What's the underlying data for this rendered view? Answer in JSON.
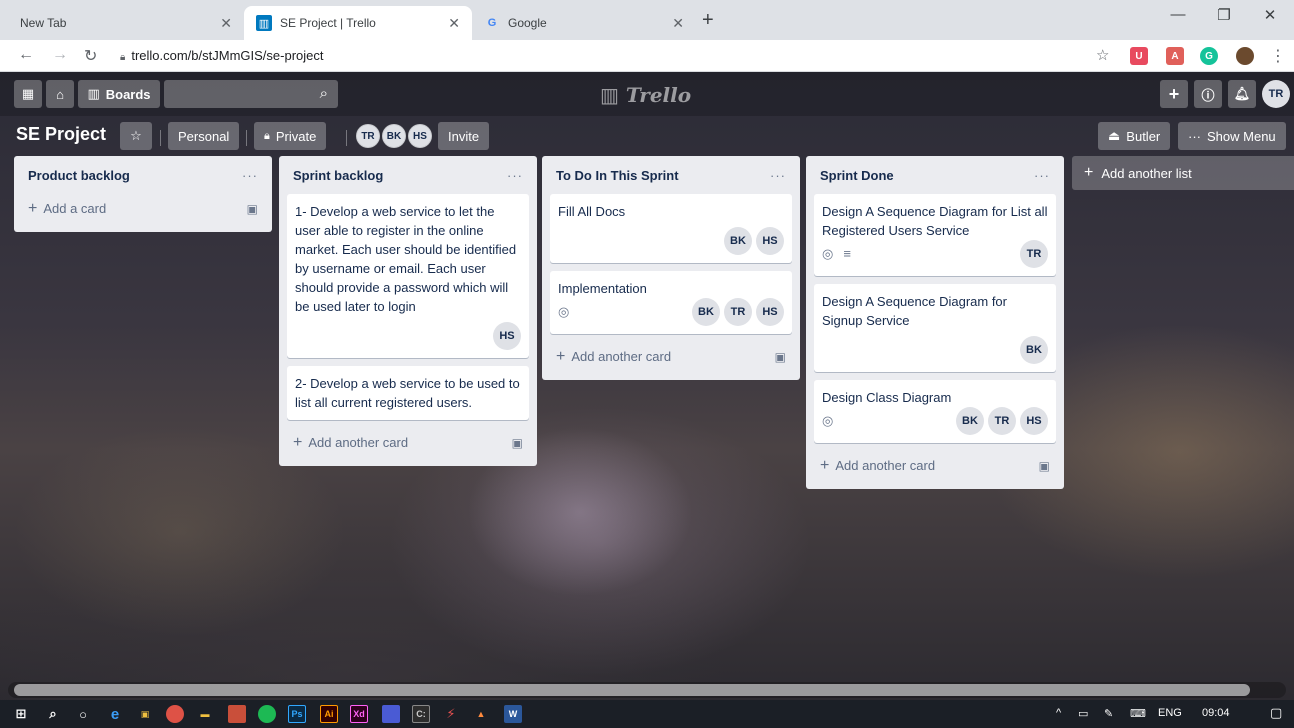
{
  "browser": {
    "tabs": [
      {
        "label": "New Tab",
        "active": false
      },
      {
        "label": "SE Project | Trello",
        "active": true
      },
      {
        "label": "Google",
        "active": false
      }
    ],
    "url": "trello.com/b/stJMmGIS/se-project"
  },
  "header": {
    "boards_label": "Boards",
    "logo_text": "Trello",
    "user_initials": "TR"
  },
  "board": {
    "title": "SE Project",
    "personal_label": "Personal",
    "private_label": "Private",
    "invite_label": "Invite",
    "butler_label": "Butler",
    "show_menu_label": "Show Menu",
    "members": [
      "TR",
      "BK",
      "HS"
    ]
  },
  "lists": [
    {
      "title": "Product backlog",
      "add_label": "Add a card",
      "cards": []
    },
    {
      "title": "Sprint backlog",
      "add_label": "Add another card",
      "cards": [
        {
          "title": "1- Develop a web service to let the user able to register in the online market. Each user should be identified by username or email. Each user should provide a password which will be used later to login",
          "members": [
            "HS"
          ],
          "watch": false,
          "desc": false
        },
        {
          "title": "2- Develop a web service to be used to list all current registered users.",
          "members": [],
          "watch": false,
          "desc": false
        }
      ]
    },
    {
      "title": "To Do In This Sprint",
      "add_label": "Add another card",
      "cards": [
        {
          "title": "Fill All Docs",
          "members": [
            "BK",
            "HS"
          ],
          "watch": false,
          "desc": false
        },
        {
          "title": "Implementation",
          "members": [
            "BK",
            "TR",
            "HS"
          ],
          "watch": true,
          "desc": false
        }
      ]
    },
    {
      "title": "Sprint Done",
      "add_label": "Add another card",
      "cards": [
        {
          "title": "Design A Sequence Diagram for List all Registered Users Service",
          "members": [
            "TR"
          ],
          "watch": true,
          "desc": true
        },
        {
          "title": "Design A Sequence Diagram for Signup Service",
          "members": [
            "BK"
          ],
          "watch": false,
          "desc": false
        },
        {
          "title": "Design Class Diagram",
          "members": [
            "BK",
            "TR",
            "HS"
          ],
          "watch": true,
          "desc": false
        }
      ]
    }
  ],
  "add_list_label": "Add another list",
  "taskbar": {
    "lang": "ENG",
    "time": "09:04"
  }
}
